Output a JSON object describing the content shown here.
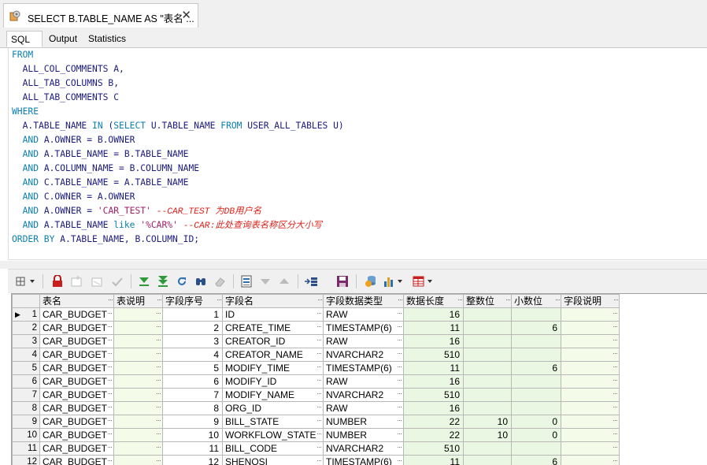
{
  "document_tab": {
    "title": "SELECT B.TABLE_NAME AS \"表名 ...",
    "close": "✕"
  },
  "sub_tabs": [
    {
      "label": "SQL",
      "active": true
    },
    {
      "label": "Output",
      "active": false
    },
    {
      "label": "Statistics",
      "active": false
    }
  ],
  "sql_lines": [
    [
      {
        "t": "kw",
        "s": "FROM"
      }
    ],
    [
      {
        "t": "tx",
        "s": "  ALL_COL_COMMENTS A,"
      }
    ],
    [
      {
        "t": "tx",
        "s": "  ALL_TAB_COLUMNS B,"
      }
    ],
    [
      {
        "t": "tx",
        "s": "  ALL_TAB_COMMENTS C"
      }
    ],
    [
      {
        "t": "kw",
        "s": "WHERE"
      }
    ],
    [
      {
        "t": "tx",
        "s": "  A.TABLE_NAME "
      },
      {
        "t": "kw",
        "s": "IN"
      },
      {
        "t": "tx",
        "s": " ("
      },
      {
        "t": "kw",
        "s": "SELECT"
      },
      {
        "t": "tx",
        "s": " U.TABLE_NAME "
      },
      {
        "t": "kw",
        "s": "FROM"
      },
      {
        "t": "tx",
        "s": " USER_ALL_TABLES U)"
      }
    ],
    [
      {
        "t": "kw",
        "s": "  AND"
      },
      {
        "t": "tx",
        "s": " A.OWNER = B.OWNER"
      }
    ],
    [
      {
        "t": "kw",
        "s": "  AND"
      },
      {
        "t": "tx",
        "s": " A.TABLE_NAME = B.TABLE_NAME"
      }
    ],
    [
      {
        "t": "kw",
        "s": "  AND"
      },
      {
        "t": "tx",
        "s": " A.COLUMN_NAME = B.COLUMN_NAME"
      }
    ],
    [
      {
        "t": "kw",
        "s": "  AND"
      },
      {
        "t": "tx",
        "s": " C.TABLE_NAME = A.TABLE_NAME"
      }
    ],
    [
      {
        "t": "kw",
        "s": "  AND"
      },
      {
        "t": "tx",
        "s": " C.OWNER = A.OWNER"
      }
    ],
    [
      {
        "t": "kw",
        "s": "  AND"
      },
      {
        "t": "tx",
        "s": " A.OWNER = "
      },
      {
        "t": "st",
        "s": "'CAR_TEST'"
      },
      {
        "t": "tx",
        "s": " "
      },
      {
        "t": "cm",
        "s": "--CAR_TEST 为DB用户名"
      }
    ],
    [
      {
        "t": "kw",
        "s": "  AND"
      },
      {
        "t": "tx",
        "s": " A.TABLE_NAME "
      },
      {
        "t": "kw",
        "s": "like"
      },
      {
        "t": "tx",
        "s": " "
      },
      {
        "t": "st",
        "s": "'%CAR%'"
      },
      {
        "t": "tx",
        "s": " "
      },
      {
        "t": "cm",
        "s": "--CAR:此处查询表名称区分大小写"
      }
    ],
    [
      {
        "t": "kw",
        "s": "ORDER BY"
      },
      {
        "t": "tx",
        "s": " A.TABLE_NAME, B.COLUMN_ID;"
      }
    ]
  ],
  "toolbar_icons": [
    "grid-options-icon",
    "lock-icon",
    "add-record-icon",
    "delete-record-icon",
    "post-check-icon",
    "fetch-next-icon",
    "fetch-all-icon",
    "refresh-icon",
    "search-binoculars-icon",
    "clear-eraser-icon",
    "single-record-view-icon",
    "next-record-icon",
    "previous-record-icon",
    "query-by-example-icon",
    "save-icon",
    "export-icon",
    "chart-icon",
    "table-layout-icon"
  ],
  "grid": {
    "columns": [
      "表名",
      "表说明",
      "字段序号",
      "字段名",
      "字段数据类型",
      "数据长度",
      "整数位",
      "小数位",
      "字段说明"
    ],
    "rows": [
      {
        "n": "1",
        "table": "CAR_BUDGET",
        "desc": "",
        "seq": "1",
        "col": "ID",
        "type": "RAW",
        "len": "16",
        "int": "",
        "dec": "",
        "cdesc": ""
      },
      {
        "n": "2",
        "table": "CAR_BUDGET",
        "desc": "",
        "seq": "2",
        "col": "CREATE_TIME",
        "type": "TIMESTAMP(6)",
        "len": "11",
        "int": "",
        "dec": "6",
        "cdesc": ""
      },
      {
        "n": "3",
        "table": "CAR_BUDGET",
        "desc": "",
        "seq": "3",
        "col": "CREATOR_ID",
        "type": "RAW",
        "len": "16",
        "int": "",
        "dec": "",
        "cdesc": ""
      },
      {
        "n": "4",
        "table": "CAR_BUDGET",
        "desc": "",
        "seq": "4",
        "col": "CREATOR_NAME",
        "type": "NVARCHAR2",
        "len": "510",
        "int": "",
        "dec": "",
        "cdesc": ""
      },
      {
        "n": "5",
        "table": "CAR_BUDGET",
        "desc": "",
        "seq": "5",
        "col": "MODIFY_TIME",
        "type": "TIMESTAMP(6)",
        "len": "11",
        "int": "",
        "dec": "6",
        "cdesc": ""
      },
      {
        "n": "6",
        "table": "CAR_BUDGET",
        "desc": "",
        "seq": "6",
        "col": "MODIFY_ID",
        "type": "RAW",
        "len": "16",
        "int": "",
        "dec": "",
        "cdesc": ""
      },
      {
        "n": "7",
        "table": "CAR_BUDGET",
        "desc": "",
        "seq": "7",
        "col": "MODIFY_NAME",
        "type": "NVARCHAR2",
        "len": "510",
        "int": "",
        "dec": "",
        "cdesc": ""
      },
      {
        "n": "8",
        "table": "CAR_BUDGET",
        "desc": "",
        "seq": "8",
        "col": "ORG_ID",
        "type": "RAW",
        "len": "16",
        "int": "",
        "dec": "",
        "cdesc": ""
      },
      {
        "n": "9",
        "table": "CAR_BUDGET",
        "desc": "",
        "seq": "9",
        "col": "BILL_STATE",
        "type": "NUMBER",
        "len": "22",
        "int": "10",
        "dec": "0",
        "cdesc": ""
      },
      {
        "n": "10",
        "table": "CAR_BUDGET",
        "desc": "",
        "seq": "10",
        "col": "WORKFLOW_STATE",
        "type": "NUMBER",
        "len": "22",
        "int": "10",
        "dec": "0",
        "cdesc": ""
      },
      {
        "n": "11",
        "table": "CAR_BUDGET",
        "desc": "",
        "seq": "11",
        "col": "BILL_CODE",
        "type": "NVARCHAR2",
        "len": "510",
        "int": "",
        "dec": "",
        "cdesc": ""
      },
      {
        "n": "12",
        "table": "CAR_BUDGET",
        "desc": "",
        "seq": "12",
        "col": "SHENQSI",
        "type": "TIMESTAMP(6)",
        "len": "11",
        "int": "",
        "dec": "6",
        "cdesc": ""
      }
    ]
  }
}
